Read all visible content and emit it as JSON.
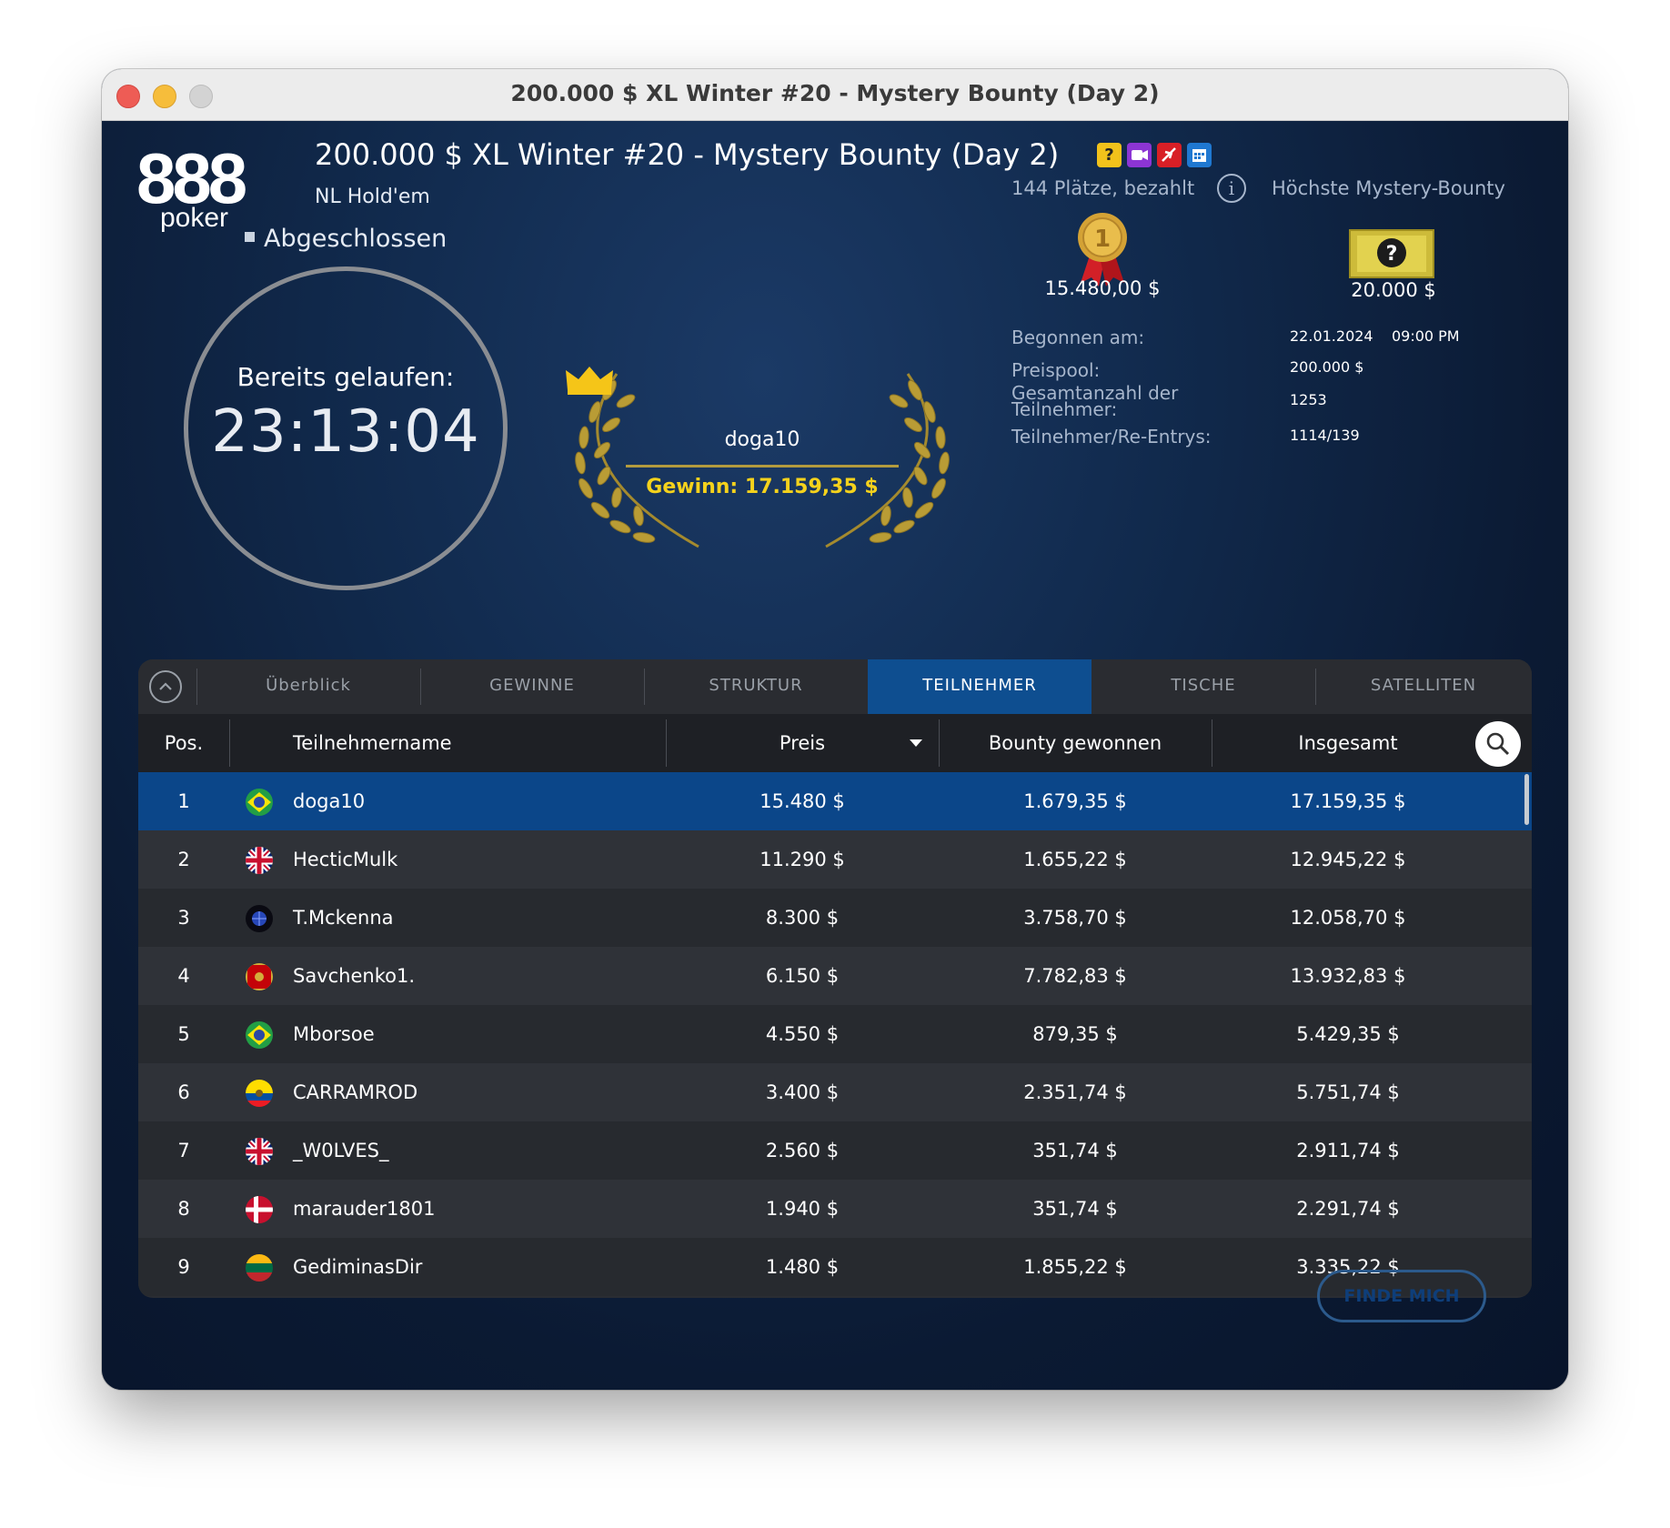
{
  "window": {
    "title": "200.000 $ XL Winter #20 - Mystery Bounty (Day 2)"
  },
  "logo": {
    "brand_number": "888",
    "brand_word": "poker"
  },
  "header": {
    "title": "200.000 $ XL Winter #20 - Mystery Bounty (Day 2)",
    "subtitle": "NL Hold'em",
    "status": "Abgeschlossen",
    "icons": [
      "mystery-bounty-icon",
      "video-icon",
      "fly-icon",
      "calendar-icon"
    ]
  },
  "clock": {
    "label": "Bereits gelaufen:",
    "time": "23:13:04"
  },
  "winner": {
    "name": "doga10",
    "winnings": "Gewinn: 17.159,35 $"
  },
  "prizes": {
    "places_text": "144 Plätze, bezahlt",
    "mystery_label": "Höchste Mystery-Bounty",
    "first_prize": "15.480,00 $",
    "mystery_prize": "20.000 $"
  },
  "details": [
    {
      "label": "Begonnen am:",
      "value": "22.01.2024    09:00 PM"
    },
    {
      "label": "Preispool:",
      "value": "200.000 $"
    },
    {
      "label": "Gesamtanzahl der Teilnehmer:",
      "value": "1253"
    },
    {
      "label": "Teilnehmer/Re-Entrys:",
      "value": "1114/139"
    }
  ],
  "tabs": [
    {
      "label": "Überblick",
      "active": false
    },
    {
      "label": "GEWINNE",
      "active": false
    },
    {
      "label": "STRUKTUR",
      "active": false
    },
    {
      "label": "TEILNEHMER",
      "active": true
    },
    {
      "label": "TISCHE",
      "active": false
    },
    {
      "label": "SATELLITEN",
      "active": false
    }
  ],
  "table": {
    "columns": {
      "pos": "Pos.",
      "name": "Teilnehmername",
      "preis": "Preis",
      "bounty": "Bounty gewonnen",
      "total": "Insgesamt"
    },
    "rows": [
      {
        "pos": "1",
        "flag": "brazil-flag-icon",
        "name": "doga10",
        "preis": "15.480 $",
        "bounty": "1.679,35 $",
        "total": "17.159,35 $",
        "selected": true
      },
      {
        "pos": "2",
        "flag": "uk-flag-icon",
        "name": "HecticMulk",
        "preis": "11.290 $",
        "bounty": "1.655,22 $",
        "total": "12.945,22 $"
      },
      {
        "pos": "3",
        "flag": "globe-flag-icon",
        "name": "T.Mckenna",
        "preis": "8.300 $",
        "bounty": "3.758,70 $",
        "total": "12.058,70 $"
      },
      {
        "pos": "4",
        "flag": "montenegro-flag-icon",
        "name": "Savchenko1.",
        "preis": "6.150 $",
        "bounty": "7.782,83 $",
        "total": "13.932,83 $"
      },
      {
        "pos": "5",
        "flag": "brazil-flag-icon",
        "name": "Mborsoe",
        "preis": "4.550 $",
        "bounty": "879,35 $",
        "total": "5.429,35 $"
      },
      {
        "pos": "6",
        "flag": "ecuador-flag-icon",
        "name": "CARRAMROD",
        "preis": "3.400 $",
        "bounty": "2.351,74 $",
        "total": "5.751,74 $"
      },
      {
        "pos": "7",
        "flag": "uk-flag-icon",
        "name": "_W0LVES_",
        "preis": "2.560 $",
        "bounty": "351,74 $",
        "total": "2.911,74 $"
      },
      {
        "pos": "8",
        "flag": "denmark-flag-icon",
        "name": "marauder1801",
        "preis": "1.940 $",
        "bounty": "351,74 $",
        "total": "2.291,74 $"
      },
      {
        "pos": "9",
        "flag": "lithuania-flag-icon",
        "name": "GediminasDir",
        "preis": "1.480 $",
        "bounty": "1.855,22 $",
        "total": "3.335,22 $"
      }
    ]
  },
  "find_me": {
    "label": "FINDE MICH"
  },
  "colors": {
    "accent": "#0e4e90",
    "gold": "#f5d21c",
    "background": "#0d1a33"
  }
}
